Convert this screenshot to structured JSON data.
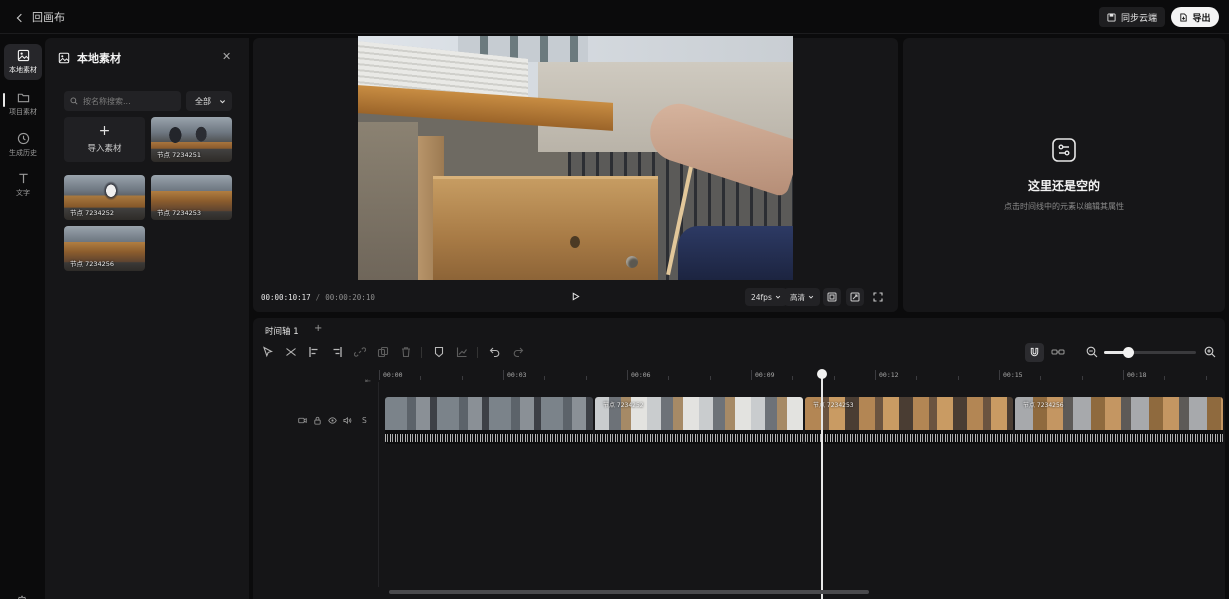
{
  "header": {
    "back_label": "回画布",
    "sync_label": "同步云端",
    "export_label": "导出"
  },
  "rail": {
    "items": [
      {
        "label": "本地素材",
        "icon": "image-icon"
      },
      {
        "label": "项目素材",
        "icon": "folder-icon"
      },
      {
        "label": "生成历史",
        "icon": "clock-icon"
      },
      {
        "label": "文字",
        "icon": "text-icon"
      }
    ],
    "settings_icon": "gear-icon"
  },
  "assets": {
    "title": "本地素材",
    "search_placeholder": "按名称搜索...",
    "filter_value": "全部",
    "import_label": "导入素材",
    "items": [
      {
        "caption": "节点 7234251"
      },
      {
        "caption": "节点 7234252"
      },
      {
        "caption": "节点 7234253"
      },
      {
        "caption": "节点 7234256"
      }
    ]
  },
  "preview": {
    "current_time": "00:00:10:17",
    "separator": "/",
    "total_time": "00:00:20:10",
    "fps": "24fps",
    "quality": "高清"
  },
  "properties": {
    "empty_title": "这里还是空的",
    "empty_hint": "点击时间线中的元素以编辑其属性"
  },
  "timeline": {
    "tab_label": "时间轴 1",
    "add_tab": "+",
    "ruler_labels": [
      "00:00",
      "00:03",
      "00:06",
      "00:09",
      "00:12",
      "00:15",
      "00:18"
    ],
    "track_s_label": "S",
    "zoom": 0.26,
    "playhead_time": "00:10",
    "clips": [
      {
        "caption": ""
      },
      {
        "caption": "节点 7234252"
      },
      {
        "caption": "节点 7234253"
      },
      {
        "caption": "节点 7234256"
      }
    ]
  },
  "colors": {
    "background": "#0b0b0c",
    "panel": "#161618",
    "accent": "#f4f4f4"
  }
}
